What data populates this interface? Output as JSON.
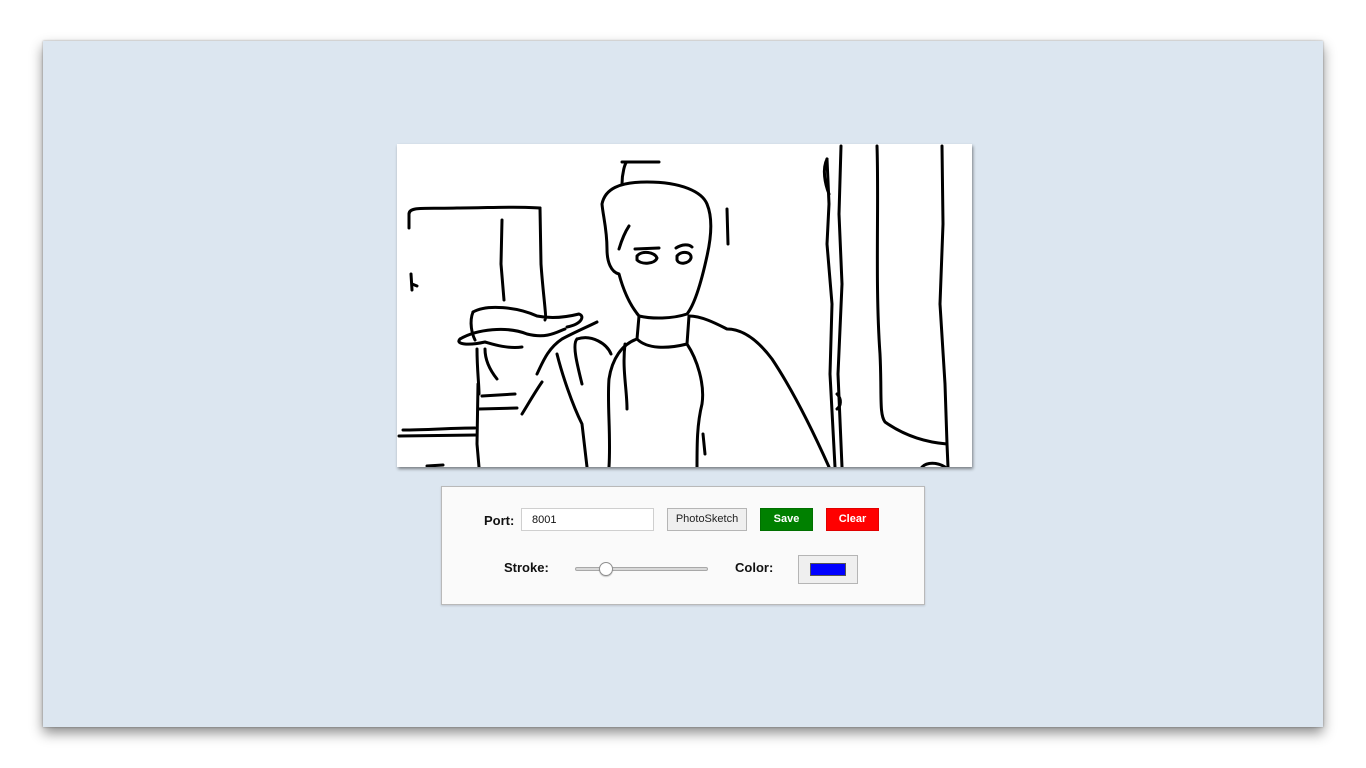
{
  "controls": {
    "port_label": "Port:",
    "port_value": "8001",
    "photosketch_label": "PhotoSketch",
    "save_label": "Save",
    "clear_label": "Clear",
    "stroke_label": "Stroke:",
    "stroke_level": 0.23,
    "color_label": "Color:"
  },
  "colors": {
    "window_background": "#dce6f0",
    "save_button": "#008000",
    "clear_button": "#ff0000",
    "stroke_color": "#0000ff",
    "sketch_ink": "#000000"
  },
  "icons": {
    "canvas": "sketch-drawing-of-person-in-room"
  }
}
